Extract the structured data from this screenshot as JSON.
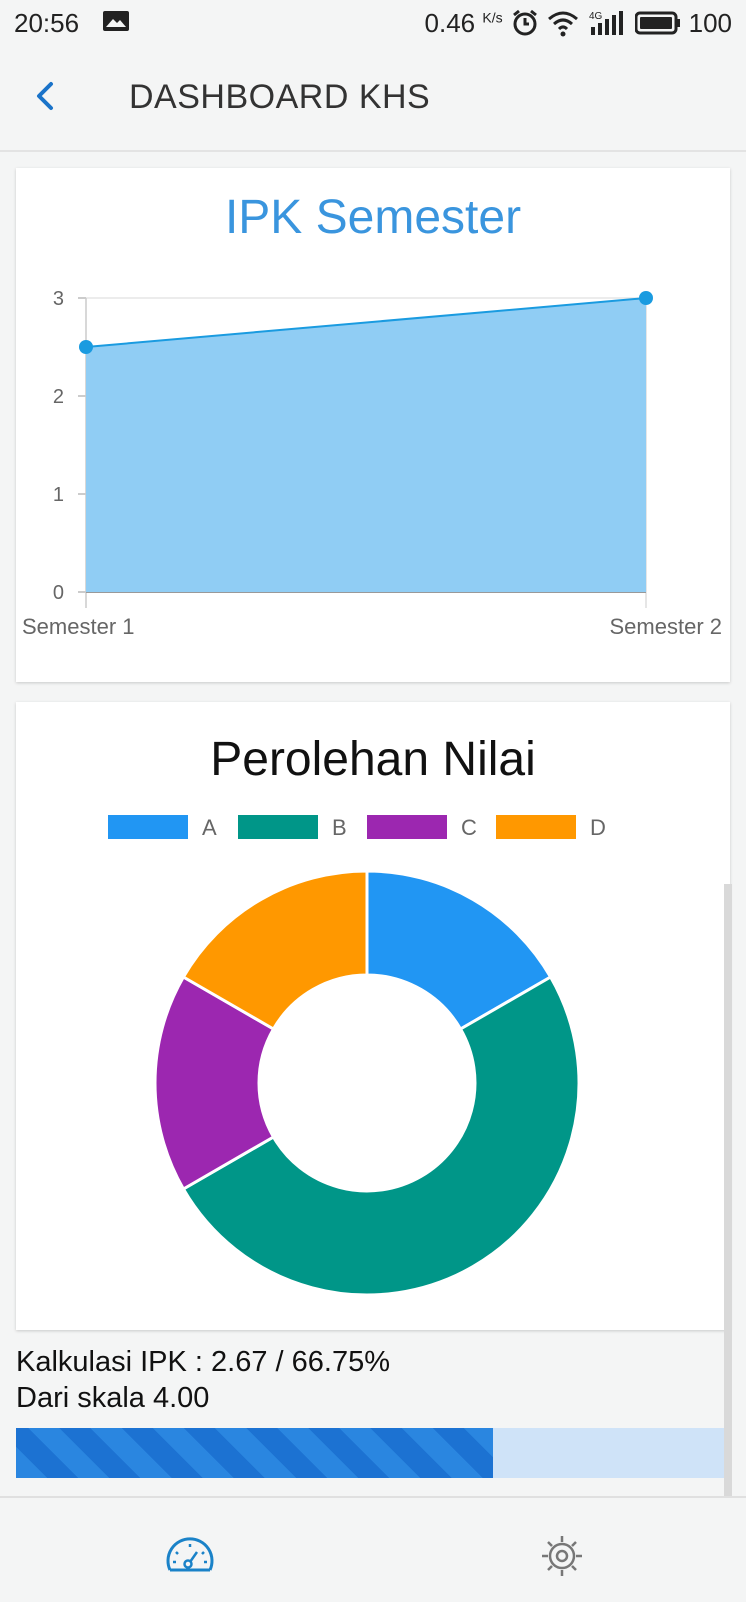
{
  "status_bar": {
    "time": "20:56",
    "speed_value": "0.46",
    "speed_unit": "K/s",
    "network": "4G",
    "battery": "100"
  },
  "app_bar": {
    "title": "DASHBOARD KHS",
    "back_icon": "chevron-left-icon"
  },
  "line_card": {
    "chart_data": {
      "type": "area",
      "title": "IPK Semester",
      "categories": [
        "Semester 1",
        "Semester 2"
      ],
      "series": [
        {
          "values": [
            2.5,
            3.0
          ]
        }
      ],
      "ylim": [
        0,
        3
      ],
      "yticks": [
        "0",
        "1",
        "2",
        "3"
      ],
      "grid": true,
      "colors": {
        "line": "#1a9be0",
        "fill": "#90cdf4"
      }
    }
  },
  "pie_card": {
    "chart_data": {
      "type": "pie",
      "title": "Perolehan Nilai",
      "categories": [
        "A",
        "B",
        "C",
        "D"
      ],
      "values": [
        1,
        3,
        1,
        1
      ],
      "colors": [
        "#2196f3",
        "#009688",
        "#9c27b0",
        "#ff9800"
      ],
      "legend": "top"
    }
  },
  "summary": {
    "line1": "Kalkulasi IPK : 2.67 / 66.75%",
    "line2": "Dari skala 4.00",
    "progress_percent": 66.75
  },
  "bottom_nav": {
    "items": [
      {
        "icon": "speedometer-icon",
        "active": true
      },
      {
        "icon": "gear-icon",
        "active": false
      }
    ]
  }
}
